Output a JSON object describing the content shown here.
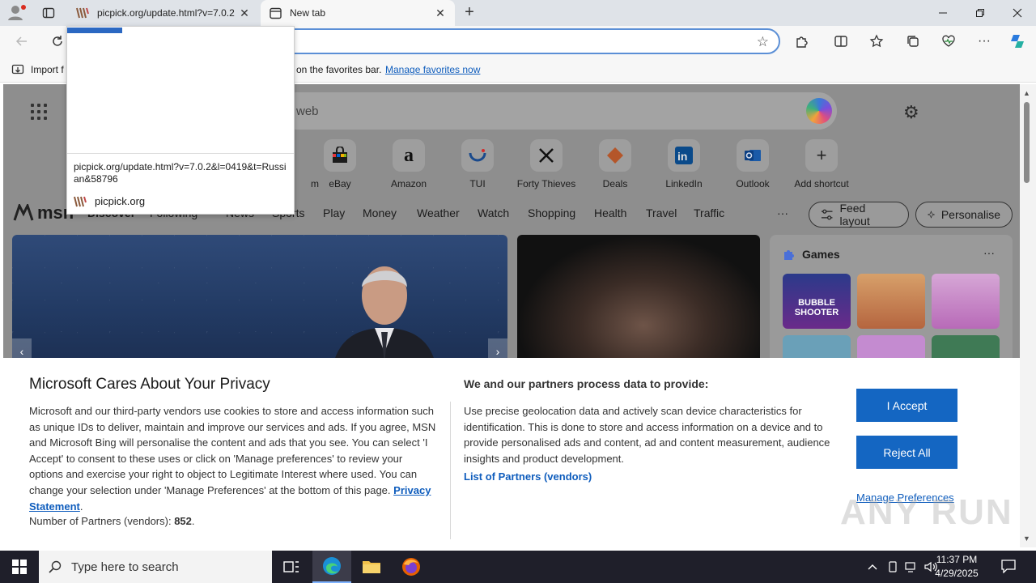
{
  "browser": {
    "tabs": [
      {
        "title": "picpick.org/update.html?v=7.0.2",
        "active": false
      },
      {
        "title": "New tab",
        "active": true
      }
    ],
    "favorites_bar": {
      "import_label": "Import f",
      "message": "on the favorites bar.",
      "manage_link": "Manage favorites now"
    }
  },
  "suggestion": {
    "url": "picpick.org/update.html?v=7.0.2&l=0419&t=Russian&58796",
    "site": "picpick.org"
  },
  "newtab": {
    "search_placeholder": "web",
    "shortcuts": [
      {
        "label": "m"
      },
      {
        "label": "eBay"
      },
      {
        "label": "Amazon"
      },
      {
        "label": "TUI"
      },
      {
        "label": "Forty Thieves"
      },
      {
        "label": "Deals"
      },
      {
        "label": "LinkedIn"
      },
      {
        "label": "Outlook"
      },
      {
        "label": "Add shortcut"
      }
    ],
    "msn": {
      "logo": "msn",
      "nav": [
        "Discover",
        "Following",
        "News",
        "Sports",
        "Play",
        "Money",
        "Weather",
        "Watch",
        "Shopping",
        "Health",
        "Travel",
        "Traffic"
      ],
      "more": "···",
      "feed_layout": "Feed layout",
      "personalise": "Personalise"
    },
    "games": {
      "title": "Games",
      "more": "···",
      "tile1_text": "BUBBLE SHOOTER"
    }
  },
  "consent": {
    "title": "Microsoft Cares About Your Privacy",
    "body": "Microsoft and our third-party vendors use cookies to store and access information such as unique IDs to deliver, maintain and improve our services and ads. If you agree, MSN and Microsoft Bing will personalise the content and ads that you see. You can select 'I Accept' to consent to these uses or click on 'Manage preferences' to review your options and exercise your right to object to Legitimate Interest where used.  You can change your selection under 'Manage Preferences' at the bottom of this page.",
    "privacy_link": "Privacy Statement",
    "partners_label": "Number of Partners (vendors):",
    "partners_count": "852",
    "purposes_title": "We and our partners process data to provide:",
    "purposes_body": "Use precise geolocation data and actively scan device characteristics for identification. This is done to store and access information on a device and to provide personalised ads and content, ad and content measurement, audience insights and product development.",
    "list_partners": "List of Partners (vendors)",
    "accept": "I Accept",
    "reject": "Reject All",
    "manage": "Manage Preferences"
  },
  "watermark": "ANY RUN",
  "taskbar": {
    "search_placeholder": "Type here to search",
    "time": "11:37 PM",
    "date": "4/29/2025"
  }
}
